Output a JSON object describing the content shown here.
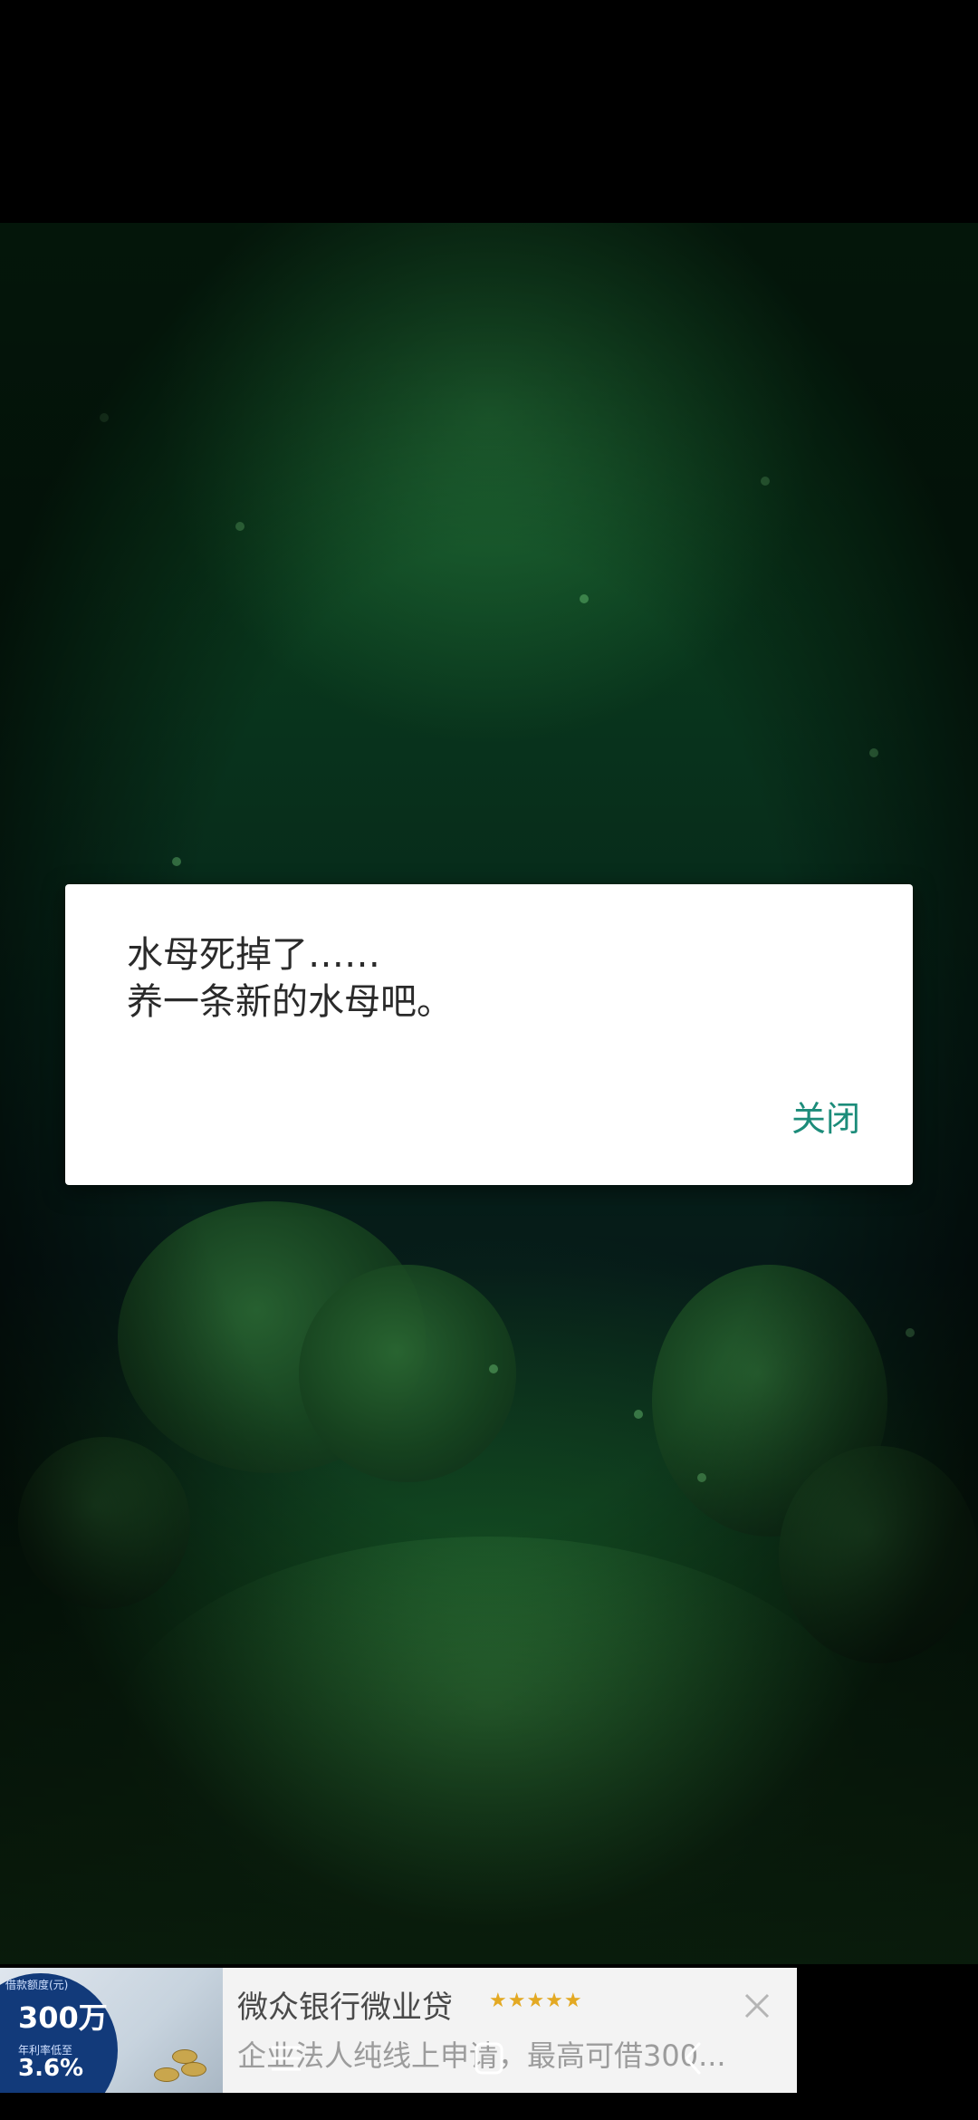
{
  "dialog": {
    "message_line1": "水母死掉了……",
    "message_line2": "养一条新的水母吧。",
    "close_label": "关闭",
    "accent_color": "#1c8c7a"
  },
  "ad": {
    "title": "微众银行微业贷",
    "stars": "★★★★★",
    "description": "企业法人纯线上申请，最高可借300...",
    "amount_label": "借款额度(元)",
    "amount": "300万",
    "rate_label": "年利率低至",
    "rate": "3.6%"
  },
  "navbar": {
    "menu_icon": "menu-icon",
    "home_icon": "home-icon",
    "back_icon": "back-icon"
  },
  "colors": {
    "background_green": "#0a3c1d",
    "dialog_background": "#ffffff",
    "ad_background": "#f3f3f3"
  }
}
